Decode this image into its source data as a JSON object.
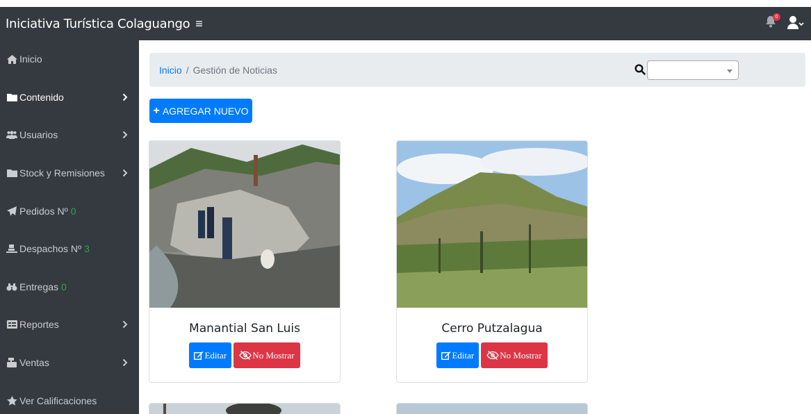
{
  "header": {
    "brand": "Iniciativa Turística Colaguango",
    "menu_icon": "hamburger-icon",
    "notification_count": "0"
  },
  "sidebar": {
    "items": [
      {
        "label": "Inicio",
        "icon": "home-icon",
        "count": "",
        "chevron": false
      },
      {
        "label": "Contenido",
        "icon": "folder-icon",
        "count": "",
        "chevron": true
      },
      {
        "label": "Usuarios",
        "icon": "users-icon",
        "count": "",
        "chevron": true
      },
      {
        "label": "Stock y Remisiones",
        "icon": "folder-icon",
        "count": "",
        "chevron": true
      },
      {
        "label": "Pedidos Nº",
        "icon": "send-icon",
        "count": "0",
        "chevron": false
      },
      {
        "label": "Despachos Nº",
        "icon": "dolly-icon",
        "count": "3",
        "chevron": false
      },
      {
        "label": "Entregas",
        "icon": "binoculars-icon",
        "count": "0",
        "chevron": false
      },
      {
        "label": "Reportes",
        "icon": "table-icon",
        "count": "",
        "chevron": true
      },
      {
        "label": "Ventas",
        "icon": "cash-register-icon",
        "count": "",
        "chevron": true
      },
      {
        "label": "Ver Calificaciones",
        "icon": "star-icon",
        "count": "",
        "chevron": false
      }
    ]
  },
  "breadcrumb": {
    "home": "Inicio",
    "separator": "/",
    "current": "Gestión de Noticias"
  },
  "search": {
    "selected": ""
  },
  "toolbar": {
    "add_label": "AGREGAR NUEVO"
  },
  "cards": [
    {
      "title": "Manantial San Luis",
      "edit_label": "Editar",
      "hide_label": "No Mostrar"
    },
    {
      "title": "Cerro Putzalagua",
      "edit_label": "Editar",
      "hide_label": "No Mostrar"
    }
  ],
  "colors": {
    "primary": "#007bff",
    "danger": "#dc3545",
    "success": "#28a745",
    "dark": "#343a40"
  }
}
